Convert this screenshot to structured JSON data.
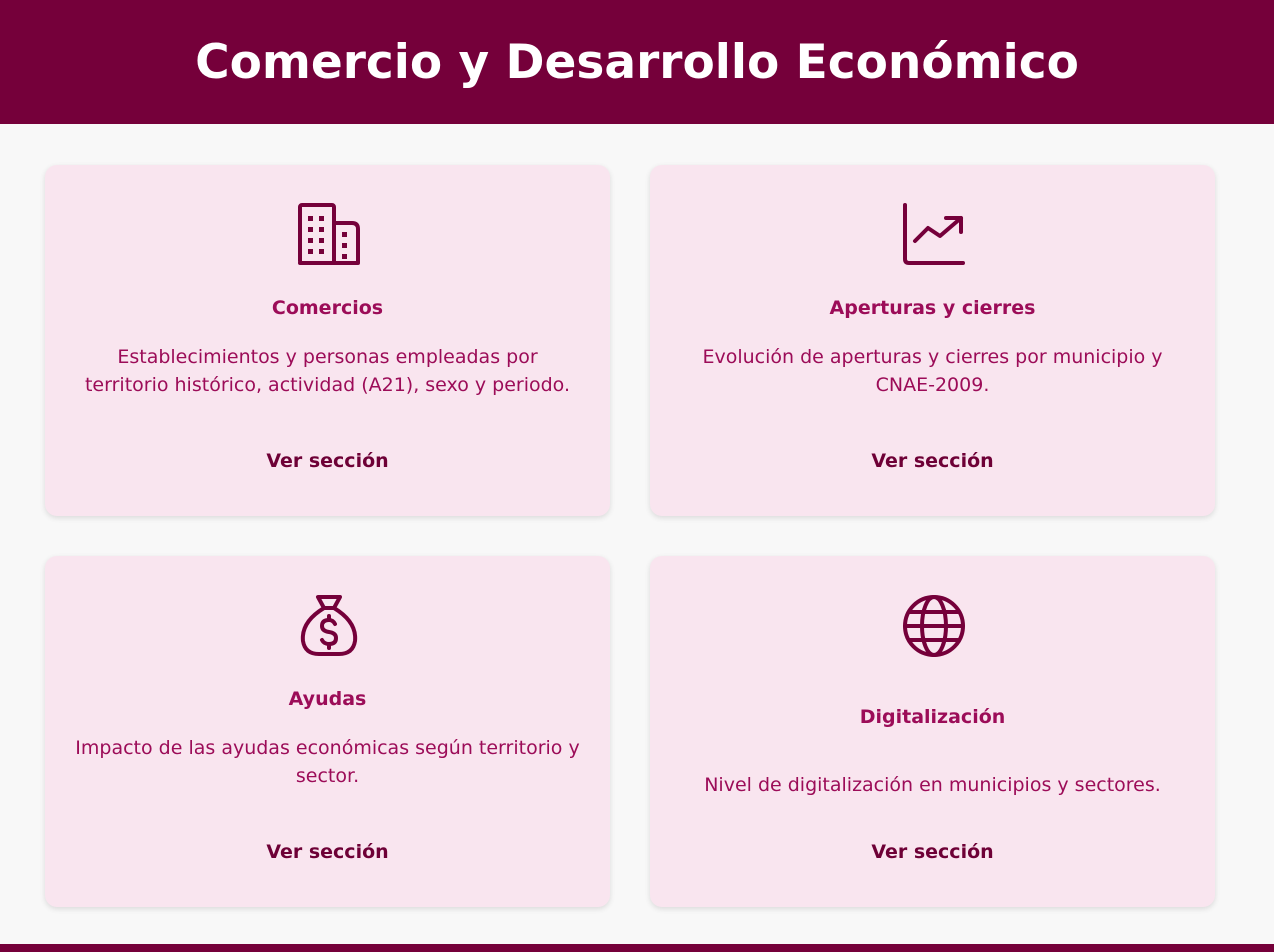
{
  "header": {
    "title": "Comercio y Desarrollo Económico"
  },
  "colors": {
    "brand": "#75003a",
    "card_bg": "#f9e5ef",
    "text_accent": "#9c0c58"
  },
  "cards": [
    {
      "icon": "building-icon",
      "title": "Comercios",
      "description": "Establecimientos y personas empleadas por territorio histórico, actividad (A21), sexo y periodo.",
      "link": "Ver sección"
    },
    {
      "icon": "chart-line-down-icon",
      "title": "Aperturas y cierres",
      "description": "Evolución de aperturas y cierres por municipio y CNAE-2009.",
      "link": "Ver sección"
    },
    {
      "icon": "money-bag-icon",
      "title": "Ayudas",
      "description": "Impacto de las ayudas económicas según territorio y sector.",
      "link": "Ver sección"
    },
    {
      "icon": "globe-icon",
      "title": "Digitalización",
      "description": "Nivel de digitalización en municipios y sectores.",
      "link": "Ver sección"
    }
  ]
}
